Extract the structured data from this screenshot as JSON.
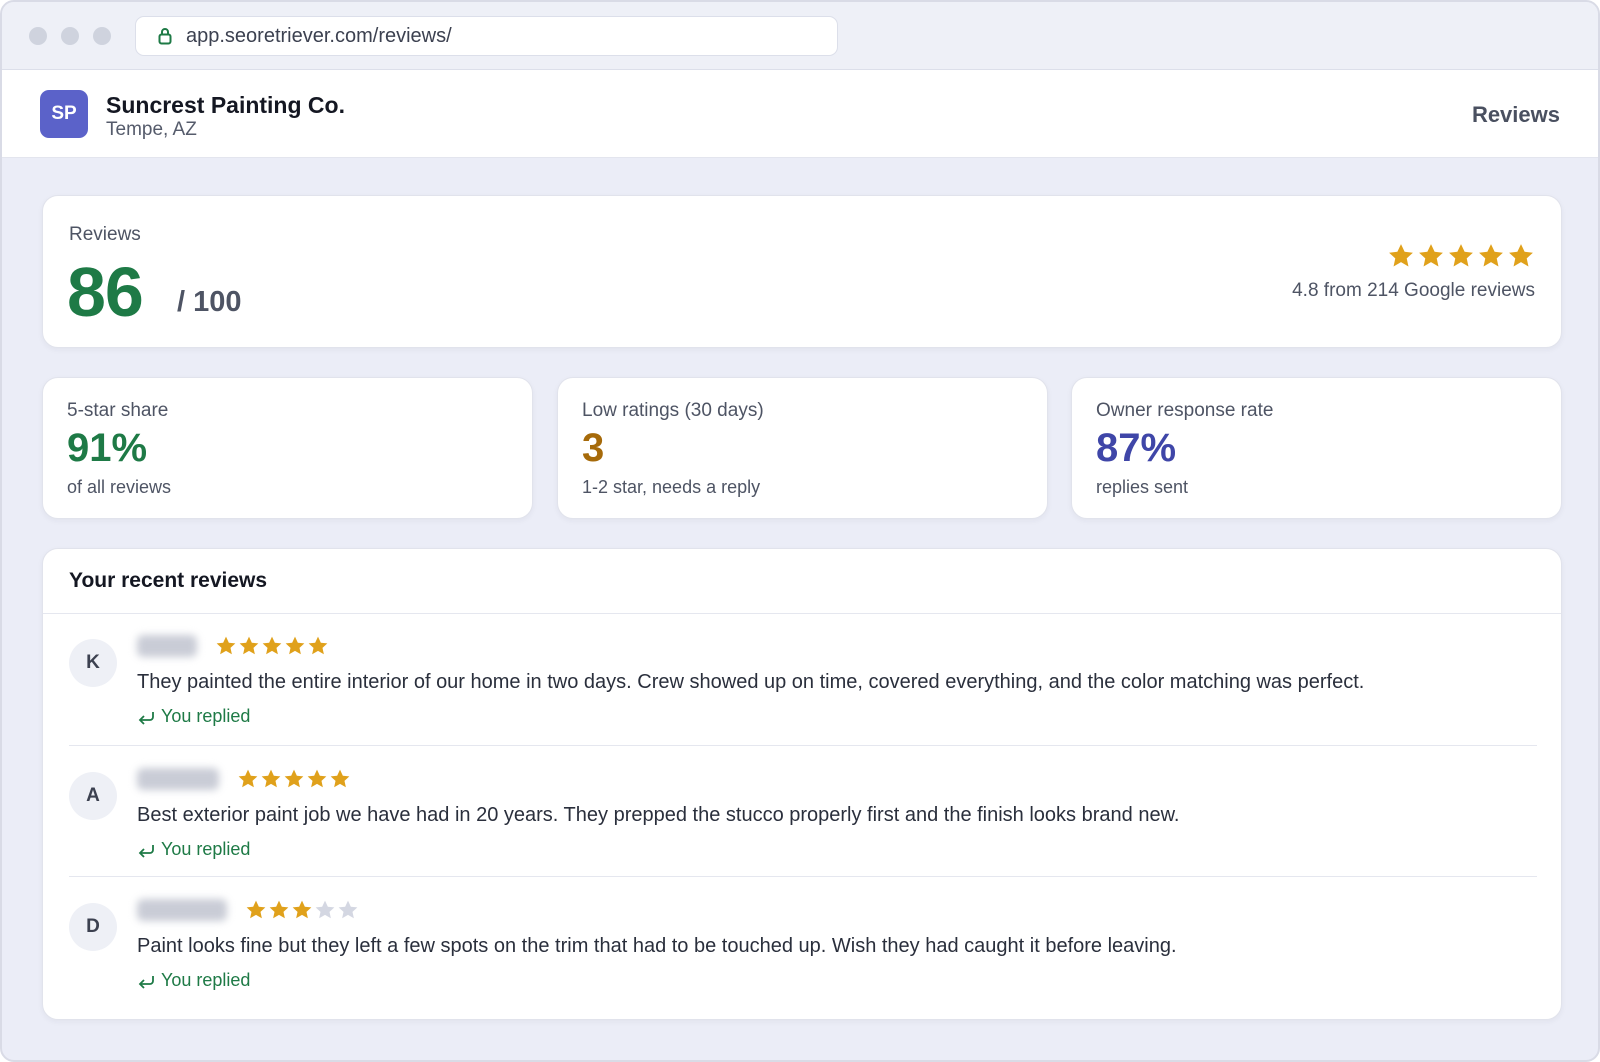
{
  "browser": {
    "url": "app.seoretriever.com/reviews/"
  },
  "header": {
    "logo_initials": "SP",
    "business_name": "Suncrest Painting Co.",
    "location": "Tempe, AZ",
    "nav_label": "Reviews"
  },
  "score": {
    "label": "Reviews",
    "value": "86",
    "max": "/ 100",
    "stars": 5,
    "rating_text": "4.8 from 214 Google reviews"
  },
  "stats": [
    {
      "label": "5-star share",
      "value": "91%",
      "sub": "of all reviews"
    },
    {
      "label": "Low ratings (30 days)",
      "value": "3",
      "sub": "1-2 star, needs a reply"
    },
    {
      "label": "Owner response rate",
      "value": "87%",
      "sub": "replies sent"
    }
  ],
  "recent": {
    "title": "Your recent reviews",
    "reviews": [
      {
        "initial": "K",
        "rating": 5,
        "text": "They painted the entire interior of our home in two days. Crew showed up on time, covered everything, and the color matching was perfect.",
        "status": "You replied"
      },
      {
        "initial": "A",
        "rating": 5,
        "text": "Best exterior paint job we have had in 20 years. They prepped the stucco properly first and the finish looks brand new.",
        "status": "You replied"
      },
      {
        "initial": "D",
        "rating": 3,
        "text": "Paint looks fine but they left a few spots on the trim that had to be touched up. Wish they had caught it before leaving.",
        "status": "You replied"
      }
    ]
  },
  "colors": {
    "star_filled": "#e0a11b",
    "star_empty": "#d4d7e2",
    "accent_green": "#1e7a46",
    "accent_amber": "#a66a0a",
    "accent_indigo": "#3f46a8",
    "logo_bg": "#5b62c9"
  },
  "icons": {
    "lock": "lock-icon",
    "star": "star-icon",
    "reply": "reply-arrow-icon"
  }
}
